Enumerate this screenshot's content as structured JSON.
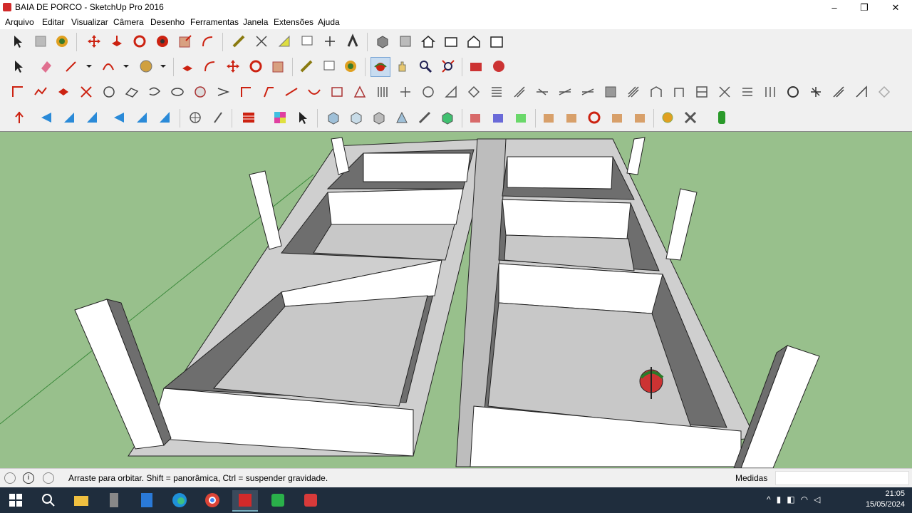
{
  "window": {
    "title": "BAIA DE PORCO - SketchUp Pro 2016",
    "minimize": "–",
    "maximize": "❐",
    "close": "✕"
  },
  "menu": [
    "Arquivo",
    "Editar",
    "Visualizar",
    "Câmera",
    "Desenho",
    "Ferramentas",
    "Janela",
    "Extensões",
    "Ajuda"
  ],
  "status": {
    "hint": "Arraste para orbitar. Shift = panorâmica, Ctrl = suspender gravidade.",
    "measure_label": "Medidas",
    "measure_value": ""
  },
  "clock": {
    "time": "21:05",
    "date": "15/05/2024"
  },
  "colors": {
    "ground": "#98c08c",
    "wall_top": "#ffffff",
    "wall_inner_dark": "#6e6e6e",
    "floor": "#c8c8c8",
    "taskbar": "#1f2d3d"
  }
}
